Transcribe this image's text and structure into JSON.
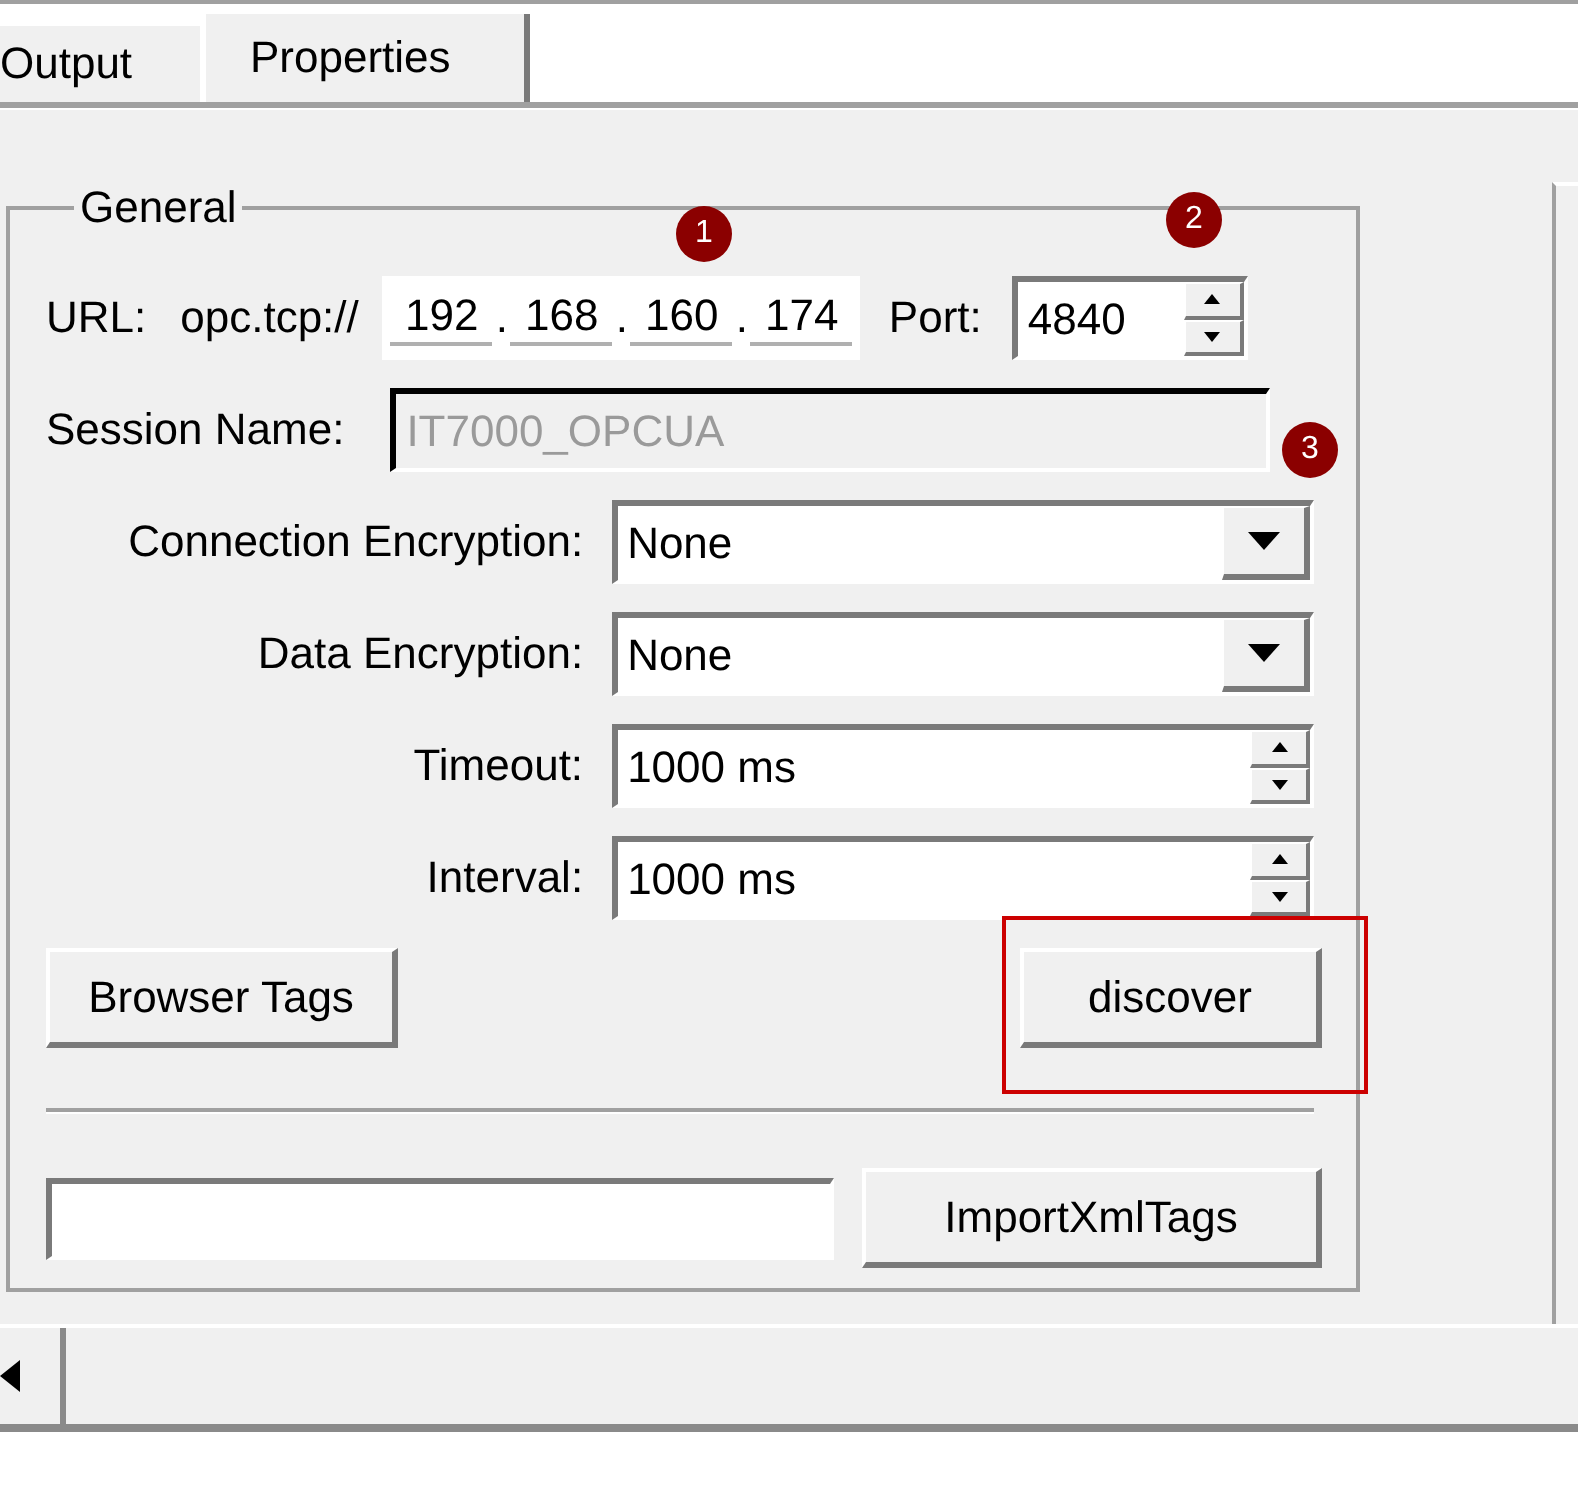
{
  "tabs": [
    {
      "label": "Output",
      "selected": false
    },
    {
      "label": "Properties",
      "selected": true
    }
  ],
  "group": {
    "title": "General",
    "url": {
      "label": "URL:",
      "scheme": "opc.tcp://",
      "octets": [
        "192",
        "168",
        "160",
        "174"
      ],
      "separator": ".",
      "port_label": "Port:",
      "port": "4840"
    },
    "session": {
      "label": "Session Name:",
      "value": "IT7000_OPCUA",
      "disabled": true
    },
    "fields": [
      {
        "kind": "dropdown",
        "label": "Connection Encryption:",
        "value": "None"
      },
      {
        "kind": "dropdown",
        "label": "Data Encryption:",
        "value": "None"
      },
      {
        "kind": "spinner",
        "label": "Timeout:",
        "value": "1000 ms"
      },
      {
        "kind": "spinner",
        "label": "Interval:",
        "value": "1000 ms"
      }
    ],
    "buttons": [
      {
        "label": "Browser Tags",
        "highlighted": false
      },
      {
        "label": "discover",
        "highlighted": true
      }
    ],
    "import_button": "ImportXmlTags"
  },
  "annotations": [
    {
      "label": "1"
    },
    {
      "label": "2"
    },
    {
      "label": "3"
    }
  ]
}
